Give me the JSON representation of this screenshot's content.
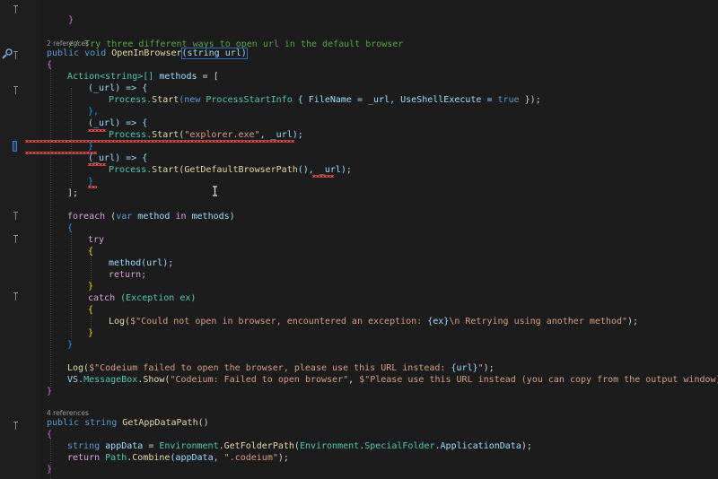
{
  "editor": {
    "codelens": {
      "open_in_browser_refs": "2 references",
      "get_app_data_path_refs": "4 references"
    },
    "lines": {
      "l1": "}",
      "comment": "// Try three different ways to open url in the default browser",
      "sig1_kw": "public void ",
      "sig1_name": "OpenInBrowser",
      "sig1_params": "(string url)",
      "brace_open": "{",
      "action_decl_type": "Action<string>[] ",
      "action_decl_name": "methods",
      "action_decl_rest": " = [",
      "lam1_open": "(_url) => {",
      "lam1_body_a": "Process.",
      "lam1_body_b": "Start",
      "lam1_body_c": "(new ",
      "lam1_body_d": "ProcessStartInfo",
      "lam1_body_e": " { FileName = _url, UseShellExecute = ",
      "lam1_body_f": "true",
      "lam1_body_g": " });",
      "lam1_close": "},",
      "lam2_open": "(_url) => {",
      "lam2_body_a": "Process.",
      "lam2_body_b": "Start",
      "lam2_body_c": "(",
      "lam2_body_d": "\"explorer.exe\"",
      "lam2_body_e": ", _url);",
      "lam2_close": "}",
      "lam3_open": "(_url) => {",
      "lam3_body_a": "Process.",
      "lam3_body_b": "Start",
      "lam3_body_c": "(",
      "lam3_body_d": "GetDefaultBrowserPath",
      "lam3_body_e": "(), _url);",
      "lam3_close": "}",
      "arr_close": "];",
      "foreach_kw": "foreach",
      "foreach_rest_a": " (",
      "foreach_var": "var ",
      "foreach_rest_b": "method ",
      "foreach_in": "in ",
      "foreach_rest_c": "methods)",
      "brace_open2": "{",
      "try_kw": "try",
      "brace_open3": "{",
      "call_method": "method(url);",
      "return_kw": "return;",
      "brace_close3": "}",
      "catch_kw": "catch ",
      "catch_rest": "(Exception ex)",
      "brace_open4": "{",
      "log1_a": "Log(",
      "log1_b": "$\"Could not open in browser, encountered an exception: ",
      "log1_c": "{ex}",
      "log1_d": "\\n Retrying using another method\"",
      "log1_e": ");",
      "brace_close4": "}",
      "brace_close2": "}",
      "log2_a": "Log(",
      "log2_b": "$\"Codeium failed to open the browser, please use this URL instead: ",
      "log2_c": "{url}",
      "log2_d": "\"",
      "log2_e": ");",
      "msg_a": "VS.",
      "msg_b": "MessageBox",
      "msg_c": ".",
      "msg_d": "Show",
      "msg_e": "(",
      "msg_f": "\"Codeium: Failed to open browser\"",
      "msg_g": ", ",
      "msg_h": "$\"Please use this URL instead (you can copy from the output window):\\n{",
      "brace_close_method": "}",
      "sig2_kw": "public string ",
      "sig2_name": "GetAppDataPath",
      "sig2_params": "()",
      "brace_open5": "{",
      "appdata_a": "string ",
      "appdata_b": "appData",
      "appdata_c": " = ",
      "appdata_d": "Environment",
      "appdata_e": ".",
      "appdata_f": "GetFolderPath",
      "appdata_g": "(",
      "appdata_h": "Environment",
      "appdata_i": ".",
      "appdata_j": "SpecialFolder",
      "appdata_k": ".",
      "appdata_l": "ApplicationData",
      "appdata_m": ");",
      "ret_a": "return ",
      "ret_b": "Path",
      "ret_c": ".",
      "ret_d": "Combine",
      "ret_e": "(appData, ",
      "ret_f": "\".codeium\"",
      "ret_g": ");",
      "brace_close5": "}"
    }
  }
}
